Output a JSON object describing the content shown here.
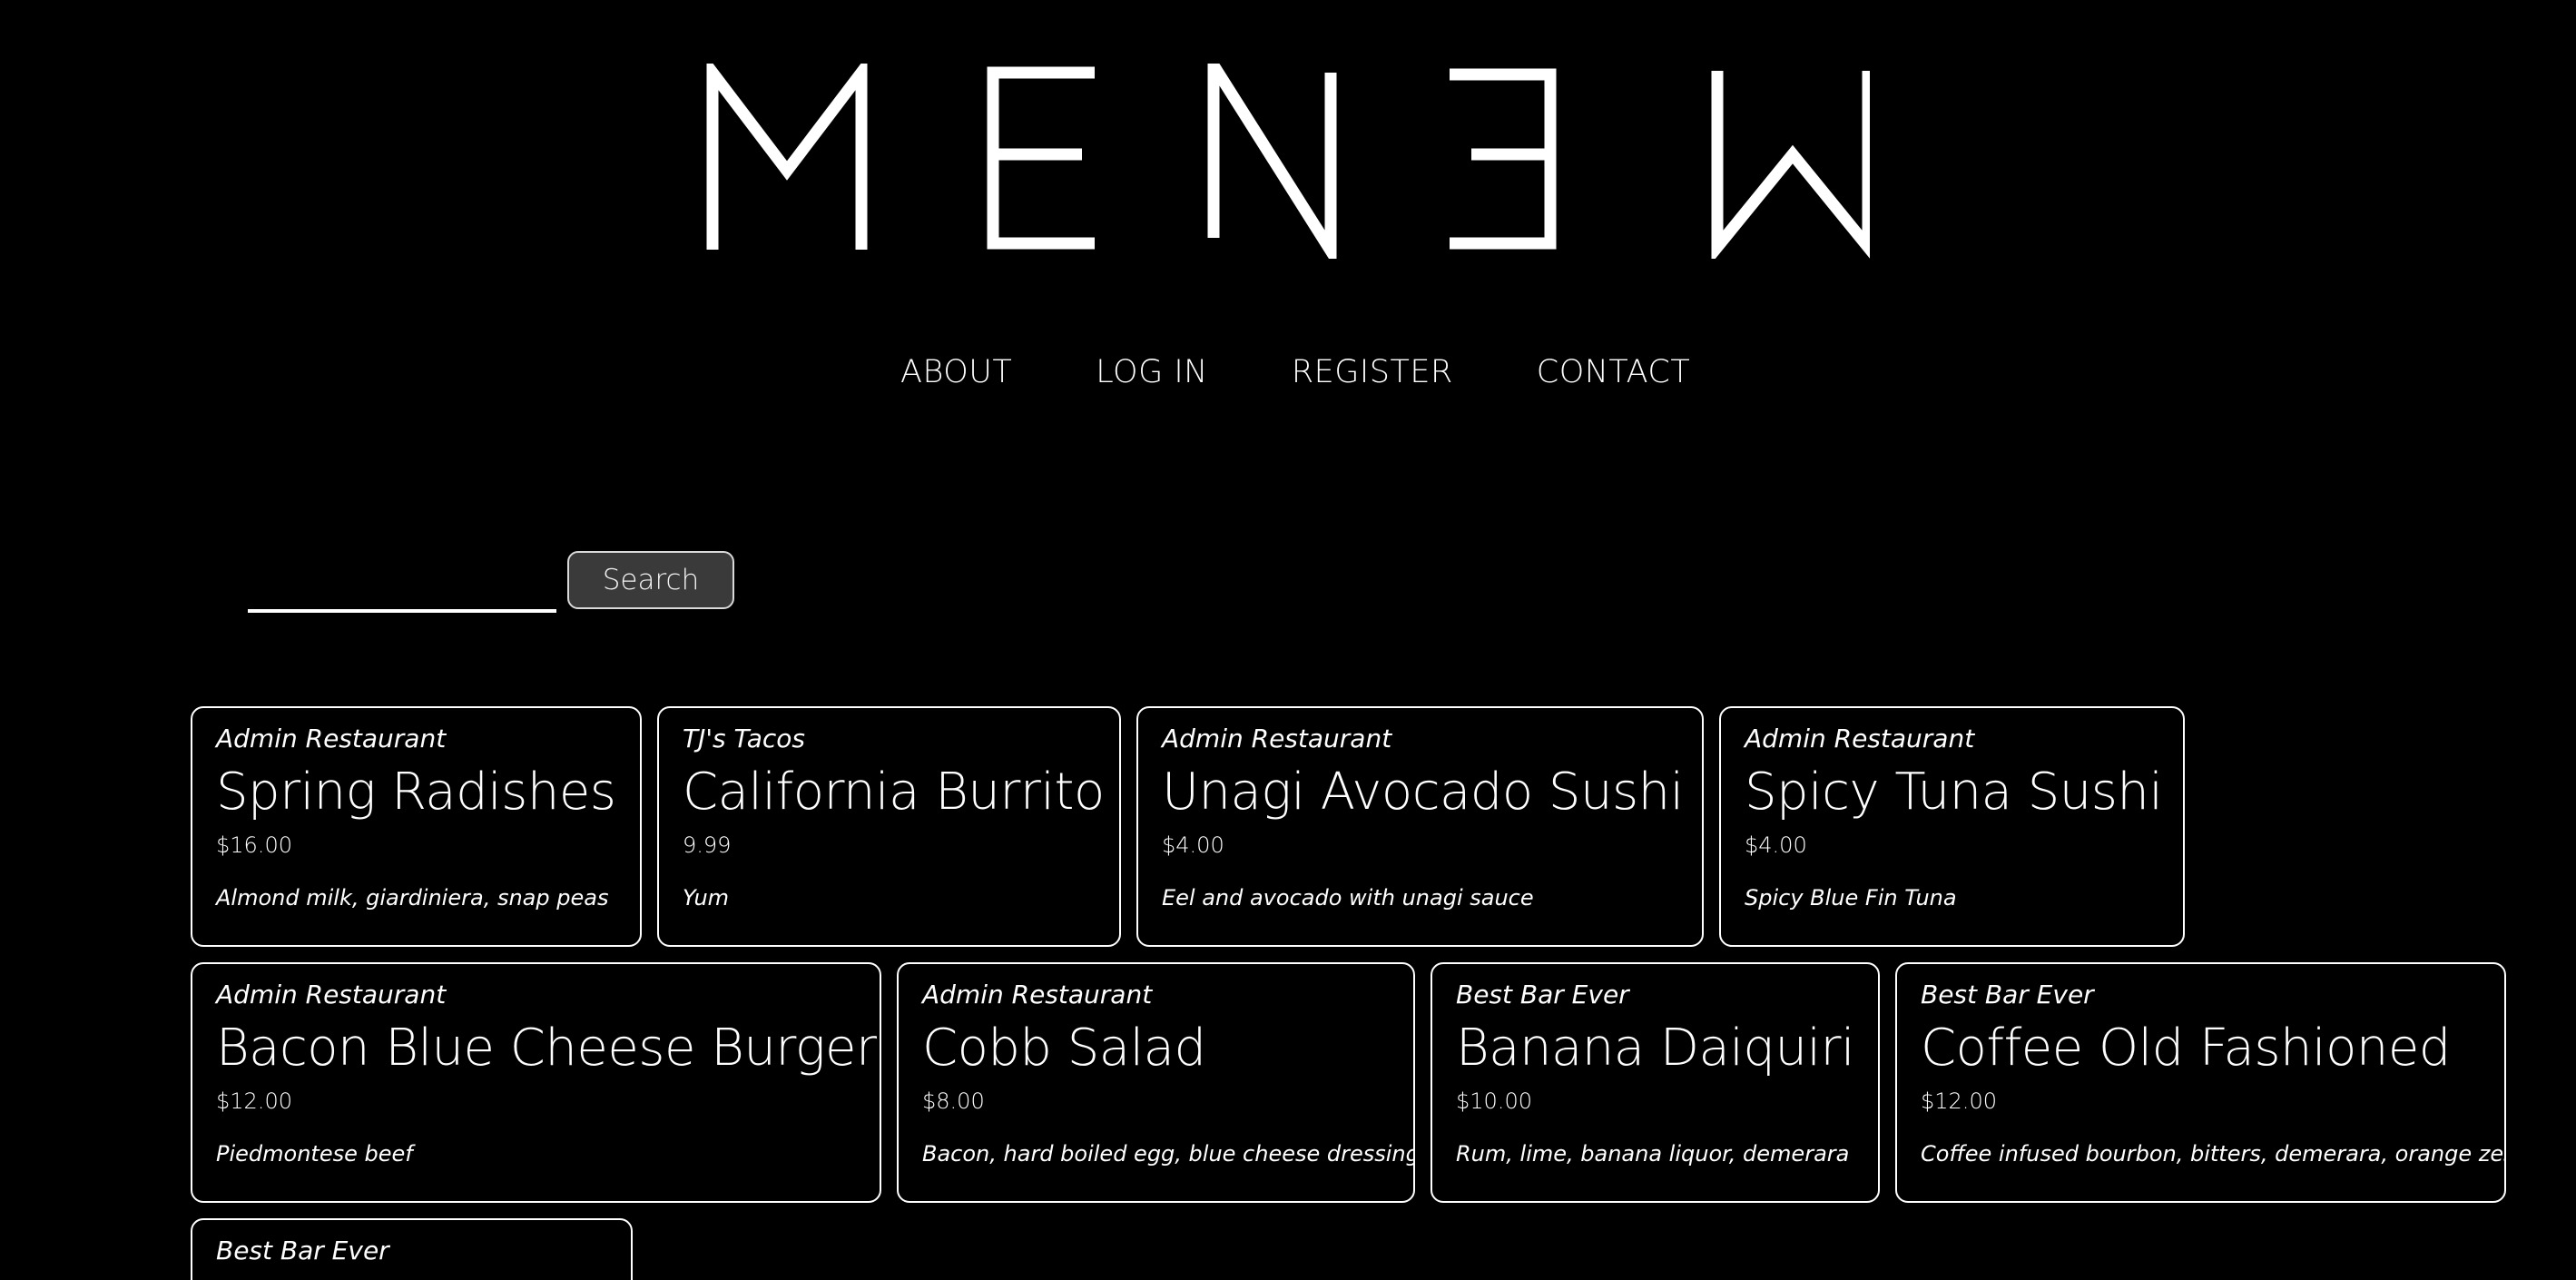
{
  "brand": {
    "logo_text": "MEN∃W"
  },
  "nav": {
    "items": [
      "ABOUT",
      "LOG IN",
      "REGISTER",
      "CONTACT"
    ]
  },
  "search": {
    "value": "",
    "placeholder": "",
    "button_label": "Search"
  },
  "menu_items": [
    {
      "restaurant": "Admin Restaurant",
      "name": "Spring Radishes",
      "price": "$16.00",
      "description": "Almond milk, giardiniera, snap peas"
    },
    {
      "restaurant": "TJ's Tacos",
      "name": "California Burrito",
      "price": "9.99",
      "description": "Yum"
    },
    {
      "restaurant": "Admin Restaurant",
      "name": "Unagi Avocado Sushi",
      "price": "$4.00",
      "description": "Eel and avocado with unagi sauce"
    },
    {
      "restaurant": "Admin Restaurant",
      "name": "Spicy Tuna Sushi",
      "price": "$4.00",
      "description": "Spicy Blue Fin Tuna"
    },
    {
      "restaurant": "Admin Restaurant",
      "name": "Bacon Blue Cheese Burger",
      "price": "$12.00",
      "description": "Piedmontese beef"
    },
    {
      "restaurant": "Admin Restaurant",
      "name": "Cobb Salad",
      "price": "$8.00",
      "description": "Bacon, hard boiled egg, blue cheese dressing"
    },
    {
      "restaurant": "Best Bar Ever",
      "name": "Banana Daiquiri",
      "price": "$10.00",
      "description": "Rum, lime, banana liquor, demerara"
    },
    {
      "restaurant": "Best Bar Ever",
      "name": "Coffee Old Fashioned",
      "price": "$12.00",
      "description": "Coffee infused bourbon, bitters, demerara, orange zest"
    },
    {
      "restaurant": "Best Bar Ever",
      "name": "",
      "price": "",
      "description": ""
    }
  ],
  "colors": {
    "background": "#000000",
    "foreground": "#ffffff",
    "button_bg": "#3a3a3a"
  }
}
